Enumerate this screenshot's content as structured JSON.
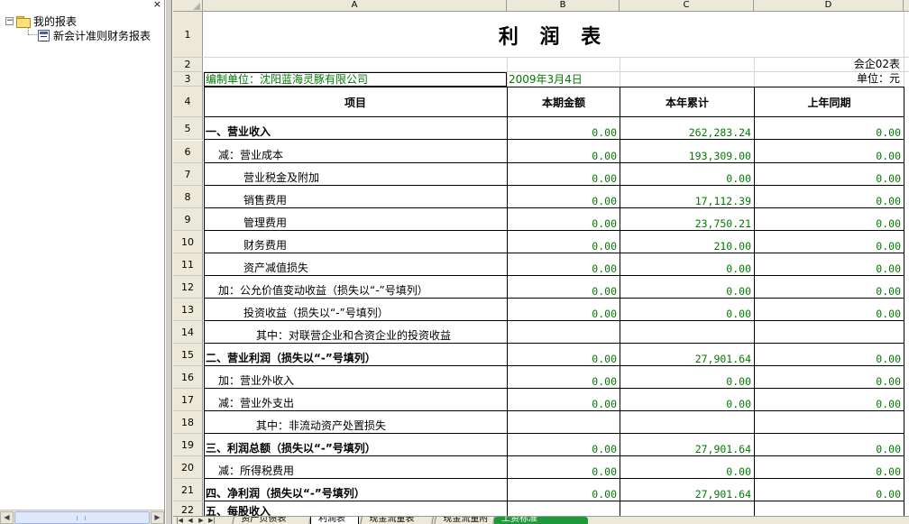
{
  "tree": {
    "close_glyph": "×",
    "expander_glyph": "−",
    "root_label": "我的报表",
    "child_label": "新会计准则财务报表"
  },
  "sheet": {
    "columns": [
      "A",
      "B",
      "C",
      "D"
    ],
    "title": "利 润 表",
    "form_code": "会企02表",
    "unit_label": "单位：元",
    "company": "编制单位：沈阳蓝海灵豚有限公司",
    "date": "2009年3月4日",
    "headers": [
      "项目",
      "本期金额",
      "本年累计",
      "上年同期"
    ],
    "rows": [
      {
        "num": "5",
        "item": "一、营业收入",
        "b": "0.00",
        "c": "262,283.24",
        "d": "0.00"
      },
      {
        "num": "6",
        "item": "减：营业成本",
        "b": "0.00",
        "c": "193,309.00",
        "d": "0.00"
      },
      {
        "num": "7",
        "item": "营业税金及附加",
        "b": "0.00",
        "c": "0.00",
        "d": "0.00"
      },
      {
        "num": "8",
        "item": "销售费用",
        "b": "0.00",
        "c": "17,112.39",
        "d": "0.00"
      },
      {
        "num": "9",
        "item": "管理费用",
        "b": "0.00",
        "c": "23,750.21",
        "d": "0.00"
      },
      {
        "num": "10",
        "item": "财务费用",
        "b": "0.00",
        "c": "210.00",
        "d": "0.00"
      },
      {
        "num": "11",
        "item": "资产减值损失",
        "b": "0.00",
        "c": "0.00",
        "d": "0.00"
      },
      {
        "num": "12",
        "item": "加：公允价值变动收益（损失以“-”号填列）",
        "b": "0.00",
        "c": "0.00",
        "d": "0.00"
      },
      {
        "num": "13",
        "item": "投资收益（损失以“-”号填列）",
        "b": "0.00",
        "c": "0.00",
        "d": "0.00"
      },
      {
        "num": "14",
        "item": "其中：对联营企业和合资企业的投资收益",
        "b": "",
        "c": "",
        "d": ""
      },
      {
        "num": "15",
        "item": "二、营业利润（损失以“-”号填列）",
        "b": "0.00",
        "c": "27,901.64",
        "d": "0.00"
      },
      {
        "num": "16",
        "item": "加：营业外收入",
        "b": "0.00",
        "c": "0.00",
        "d": "0.00"
      },
      {
        "num": "17",
        "item": "减：营业外支出",
        "b": "0.00",
        "c": "0.00",
        "d": "0.00"
      },
      {
        "num": "18",
        "item": "其中：非流动资产处置损失",
        "b": "",
        "c": "",
        "d": ""
      },
      {
        "num": "19",
        "item": "三、利润总额（损失以“-”号填列）",
        "b": "0.00",
        "c": "27,901.64",
        "d": "0.00"
      },
      {
        "num": "20",
        "item": "减：所得税费用",
        "b": "0.00",
        "c": "0.00",
        "d": "0.00"
      },
      {
        "num": "21",
        "item": "四、净利润（损失以“-”号填列）",
        "b": "0.00",
        "c": "27,901.64",
        "d": "0.00"
      },
      {
        "num": "22",
        "item": "五、每股收入",
        "b": "",
        "c": "",
        "d": ""
      }
    ],
    "row_headers_top": [
      "1",
      "2",
      "3",
      "4"
    ]
  },
  "tabs": [
    "资产负债表",
    "利润表",
    "现金流量表",
    "现金流量附",
    "工资标准"
  ],
  "colors": {
    "number_green": "#007a00",
    "active_tab_green": "#1f9a3a",
    "chrome": "#ece9d8"
  }
}
